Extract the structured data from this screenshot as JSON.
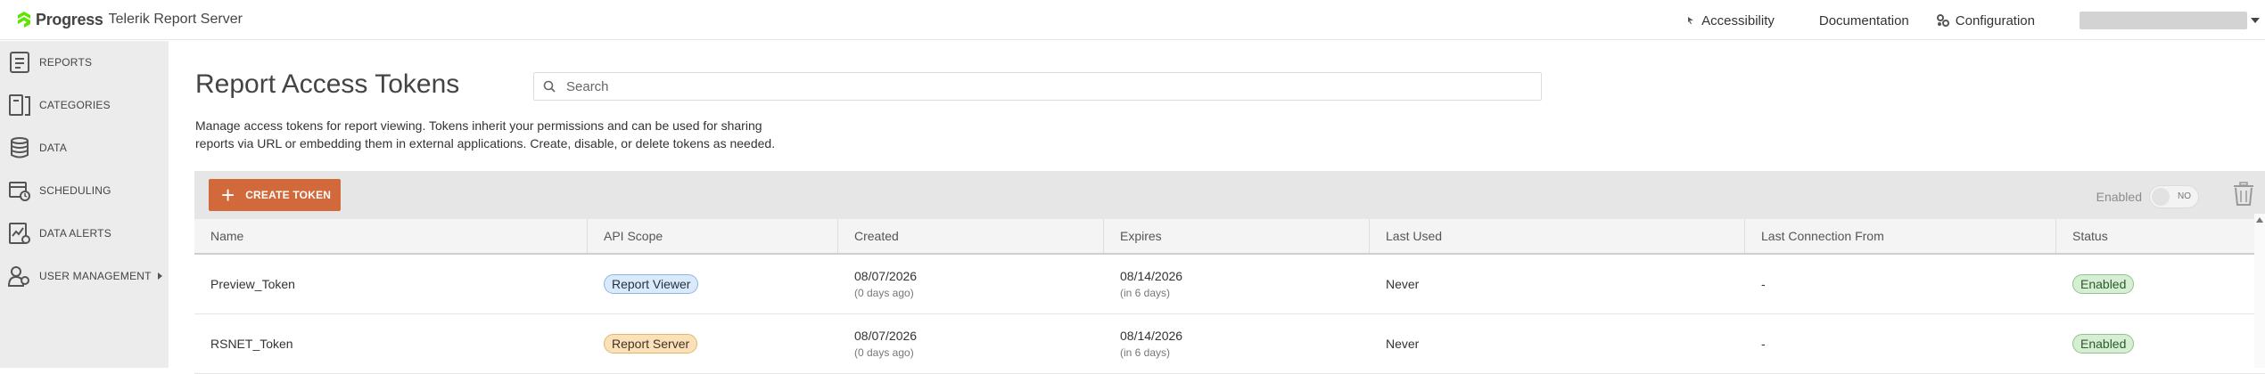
{
  "brand": {
    "progress": "Progress",
    "product": "Telerik Report Server"
  },
  "topnav": {
    "accessibility": "Accessibility",
    "documentation": "Documentation",
    "configuration": "Configuration"
  },
  "sidebar": {
    "items": [
      {
        "label": "REPORTS",
        "icon": "reports-icon"
      },
      {
        "label": "CATEGORIES",
        "icon": "categories-icon"
      },
      {
        "label": "DATA",
        "icon": "data-icon"
      },
      {
        "label": "SCHEDULING",
        "icon": "scheduling-icon"
      },
      {
        "label": "DATA ALERTS",
        "icon": "data-alerts-icon"
      },
      {
        "label": "USER MANAGEMENT",
        "icon": "user-management-icon"
      }
    ]
  },
  "page": {
    "title": "Report Access Tokens",
    "search_placeholder": "Search",
    "description_line1": "Manage access tokens for report viewing. Tokens inherit your permissions and can be used for sharing",
    "description_line2": "reports via URL or embedding them in external applications. Create, disable, or delete tokens as needed."
  },
  "toolbar": {
    "create_label": "CREATE TOKEN",
    "enabled_label": "Enabled",
    "toggle_text": "NO",
    "toggle_on": false
  },
  "table": {
    "columns": [
      "Name",
      "API Scope",
      "Created",
      "Expires",
      "Last Used",
      "Last Connection From",
      "Status"
    ],
    "rows": [
      {
        "name": "Preview_Token",
        "scope": "Report Viewer",
        "created": "08/07/2026",
        "created_rel": "(0 days ago)",
        "expires": "08/14/2026",
        "expires_rel": "(in 6 days)",
        "last_used": "Never",
        "last_conn": "-",
        "status": "Enabled"
      },
      {
        "name": "RSNET_Token",
        "scope": "Report Server",
        "created": "08/07/2026",
        "created_rel": "(0 days ago)",
        "expires": "08/14/2026",
        "expires_rel": "(in 6 days)",
        "last_used": "Never",
        "last_conn": "-",
        "status": "Enabled"
      }
    ]
  },
  "colors": {
    "accent": "#d2693b",
    "brand_green": "#5ce500",
    "sidebar_bg": "#ececec",
    "toolbar_bg": "#e6e6e6"
  }
}
